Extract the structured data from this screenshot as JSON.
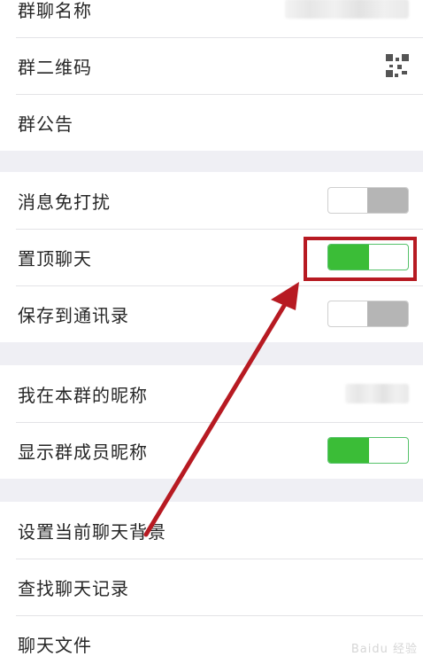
{
  "group1": {
    "items": [
      {
        "label": "群聊名称"
      },
      {
        "label": "群二维码"
      },
      {
        "label": "群公告"
      }
    ]
  },
  "group2": {
    "items": [
      {
        "label": "消息免打扰",
        "switch": "off"
      },
      {
        "label": "置顶聊天",
        "switch": "on"
      },
      {
        "label": "保存到通讯录",
        "switch": "off"
      }
    ]
  },
  "group3": {
    "items": [
      {
        "label": "我在本群的昵称"
      },
      {
        "label": "显示群成员昵称",
        "switch": "on"
      }
    ]
  },
  "group4": {
    "items": [
      {
        "label": "设置当前聊天背景"
      },
      {
        "label": "查找聊天记录"
      },
      {
        "label": "聊天文件"
      }
    ]
  },
  "colors": {
    "background": "#efeff4",
    "switch_on": "#3bbd37",
    "switch_off": "#b5b5b5",
    "annotation": "#b71a22"
  },
  "watermark": {
    "text": "Baidu 经验"
  }
}
